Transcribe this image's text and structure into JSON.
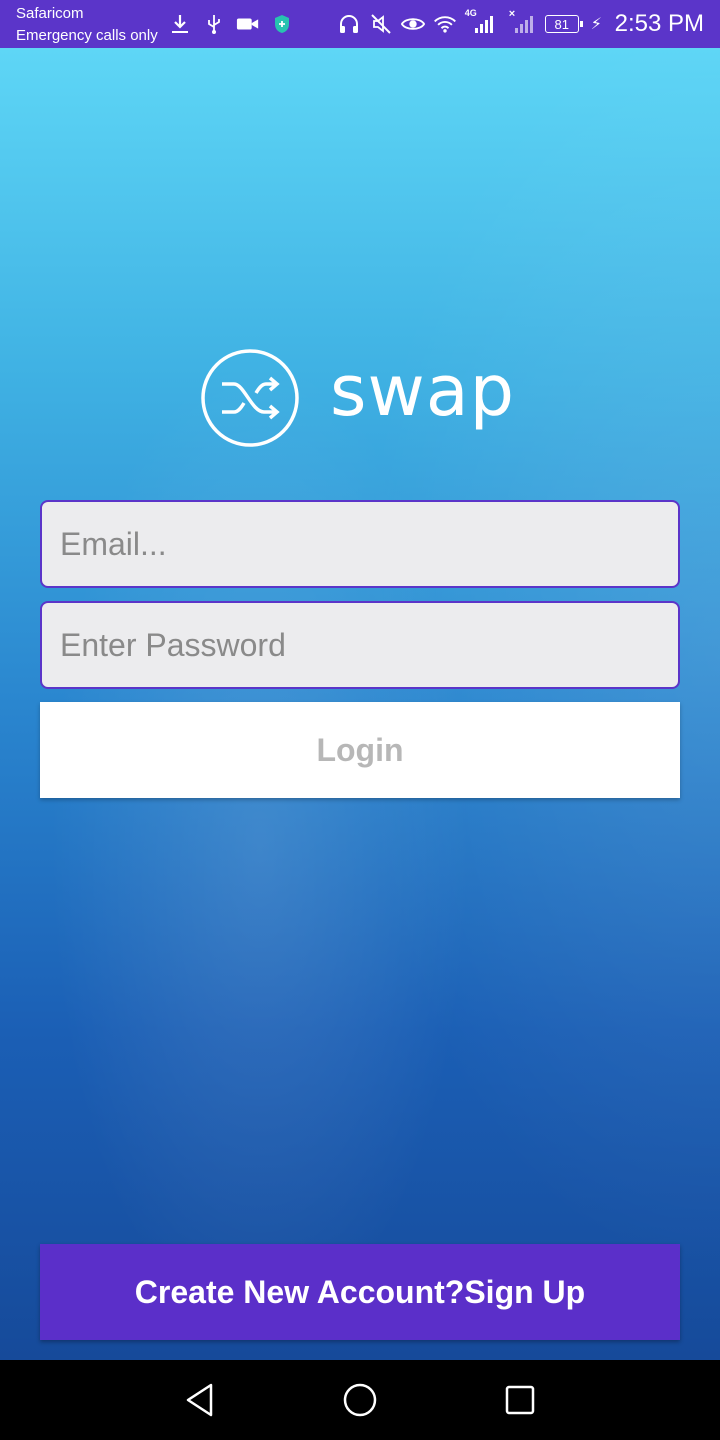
{
  "status_bar": {
    "carrier": "Safaricom",
    "carrier_status": "Emergency calls only",
    "network_label": "4G",
    "battery": "81",
    "time": "2:53 PM"
  },
  "logo": {
    "text": "swap",
    "icon": "shuffle-icon"
  },
  "form": {
    "email_placeholder": "Email...",
    "password_placeholder": "Enter Password",
    "login_label": "Login"
  },
  "signup": {
    "label": "Create New Account?Sign Up"
  },
  "colors": {
    "status_bar": "#5b35c9",
    "accent": "#5b2fc9",
    "gradient_top": "#5ed6f6",
    "gradient_bottom": "#164a9a"
  }
}
